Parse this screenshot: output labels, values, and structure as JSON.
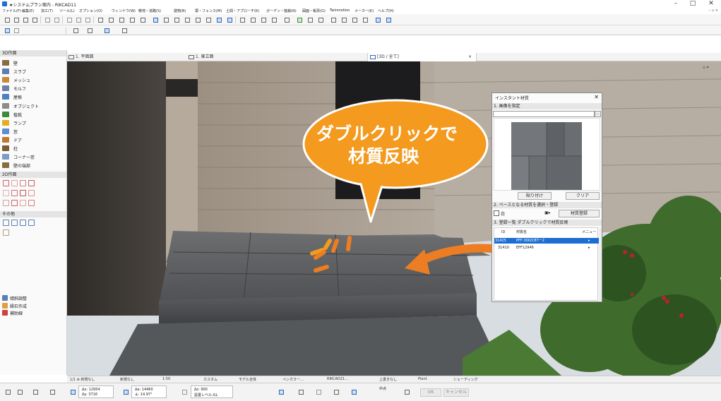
{
  "window": {
    "title": "★システムプラン案内 - RIKCAD11",
    "controls": {
      "minimize": "–",
      "maximize": "□",
      "close": "✕"
    }
  },
  "menu": {
    "items": [
      "ファイル(F)",
      "編集(E)",
      "加工(T)",
      "ツール(L)",
      "オプション(O)",
      "ウィンドウ(W)",
      "敷地・道路(S)",
      "建物(B)",
      "塀・フェンス(M)",
      "土間・アプローチ(K)",
      "ガーデン・植栽(N)",
      "図面・帳票(G)",
      "Twinmotion",
      "メーカー(K)",
      "ヘルプ(H)"
    ],
    "mini_window_buttons": "– ▫ ×"
  },
  "left_panel": {
    "header_3d": "3D作図",
    "items_3d": [
      {
        "label": "壁",
        "icon": "wall-icon",
        "color": "#8a6b3d"
      },
      {
        "label": "スラブ",
        "icon": "slab-icon",
        "color": "#5b7fb2"
      },
      {
        "label": "メッシュ",
        "icon": "mesh-icon",
        "color": "#c98a3a"
      },
      {
        "label": "モルフ",
        "icon": "morph-icon",
        "color": "#6b7fa8"
      },
      {
        "label": "屋根",
        "icon": "roof-icon",
        "color": "#4f7fc0"
      },
      {
        "label": "オブジェクト",
        "icon": "object-icon",
        "color": "#8c8c8c"
      },
      {
        "label": "植栽",
        "icon": "plant-icon",
        "color": "#3d8a3d"
      },
      {
        "label": "ランプ",
        "icon": "lamp-icon",
        "color": "#e0b020"
      },
      {
        "label": "窓",
        "icon": "window-icon",
        "color": "#5b8fd0"
      },
      {
        "label": "ドア",
        "icon": "door-icon",
        "color": "#c07a30"
      },
      {
        "label": "柱",
        "icon": "column-icon",
        "color": "#7a5a30"
      },
      {
        "label": "コーナー窓",
        "icon": "corner-window-icon",
        "color": "#7a9cc8"
      },
      {
        "label": "壁の端部",
        "icon": "wall-end-icon",
        "color": "#8a6b3d"
      }
    ],
    "header_2d": "2D作図",
    "header_other": "その他",
    "items_bottom": [
      {
        "label": "傾斜調整",
        "icon": "slope-icon",
        "color": "#5b7fb2"
      },
      {
        "label": "縁石作成",
        "icon": "curb-icon",
        "color": "#e0a040"
      },
      {
        "label": "補助線",
        "icon": "guide-line-icon",
        "color": "#d04040"
      }
    ]
  },
  "tabs": {
    "items": [
      {
        "label": "1. 平面図",
        "icon": "floorplan-icon"
      },
      {
        "label": "1. 東立面",
        "icon": "elevation-icon"
      },
      {
        "label": "[3D / 全て]",
        "icon": "3d-window-icon"
      }
    ],
    "close": "×"
  },
  "callout": {
    "line1": "ダブルクリックで",
    "line2": "材質反映",
    "fill_color": "#f39a1f",
    "arrow_color": "#ec7d22"
  },
  "dialog": {
    "title": "インスタント材質",
    "close": "✕",
    "section1": "1. 画像を指定",
    "path_value": "",
    "browse_label": "...",
    "paste_button": "貼り付け",
    "clear_button": "クリア",
    "section2": "2. ベースとなる材質を選択・登録",
    "base_label": "白",
    "register_button": "材質登録",
    "section3": "3. 登録一覧 ダブルクリックで材質反映",
    "columns": {
      "id": "ID",
      "name": "材質名",
      "menu": "メニュー"
    },
    "rows": [
      {
        "id": "31425",
        "name": "PFF-300/CBTー2",
        "selected": true
      },
      {
        "id": "31410",
        "name": "EFF12946",
        "selected": false
      }
    ]
  },
  "statusbar": {
    "items": [
      "1/1 ⊕ 新規なし",
      "新規なし",
      "1:50",
      "カスタム",
      "モデル全体",
      "ペンカラー…",
      "RIKCAD21…",
      "上書きなし",
      "Plant",
      "シェーディング"
    ]
  },
  "coords": {
    "dx": "Δx: 12954",
    "dy": "Δy: 3716",
    "ax": "Δa: 14460",
    "ar": "∡: 14.97°",
    "z": "Δz: 900",
    "zref": "設置レベル:GL",
    "z_label": "中点",
    "ok": "OK",
    "cancel": "キャンセル"
  }
}
